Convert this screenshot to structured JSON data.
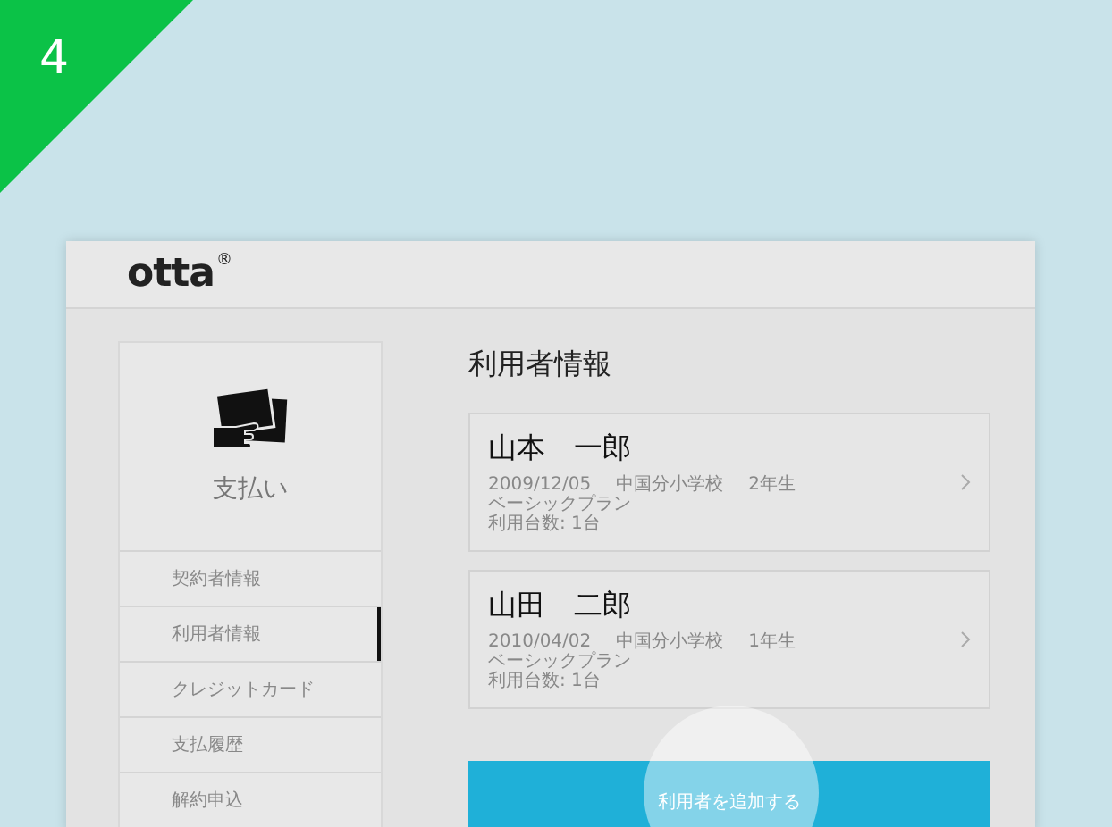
{
  "step_badge": "4",
  "header": {
    "logo": "otta",
    "logo_mark": "®"
  },
  "sidebar": {
    "title": "支払い",
    "items": [
      {
        "label": "契約者情報",
        "selected": false
      },
      {
        "label": "利用者情報",
        "selected": true
      },
      {
        "label": "クレジットカード",
        "selected": false
      },
      {
        "label": "支払履歴",
        "selected": false
      },
      {
        "label": "解約申込",
        "selected": false
      }
    ]
  },
  "main": {
    "title": "利用者情報",
    "users": [
      {
        "name": "山本　一郎",
        "birthdate": "2009/12/05",
        "school": "中国分小学校",
        "grade": "2年生",
        "plan": "ベーシックプラン",
        "devices": "利用台数: 1台"
      },
      {
        "name": "山田　二郎",
        "birthdate": "2010/04/02",
        "school": "中国分小学校",
        "grade": "1年生",
        "plan": "ベーシックプラン",
        "devices": "利用台数: 1台"
      }
    ],
    "add_button": "利用者を追加する"
  }
}
